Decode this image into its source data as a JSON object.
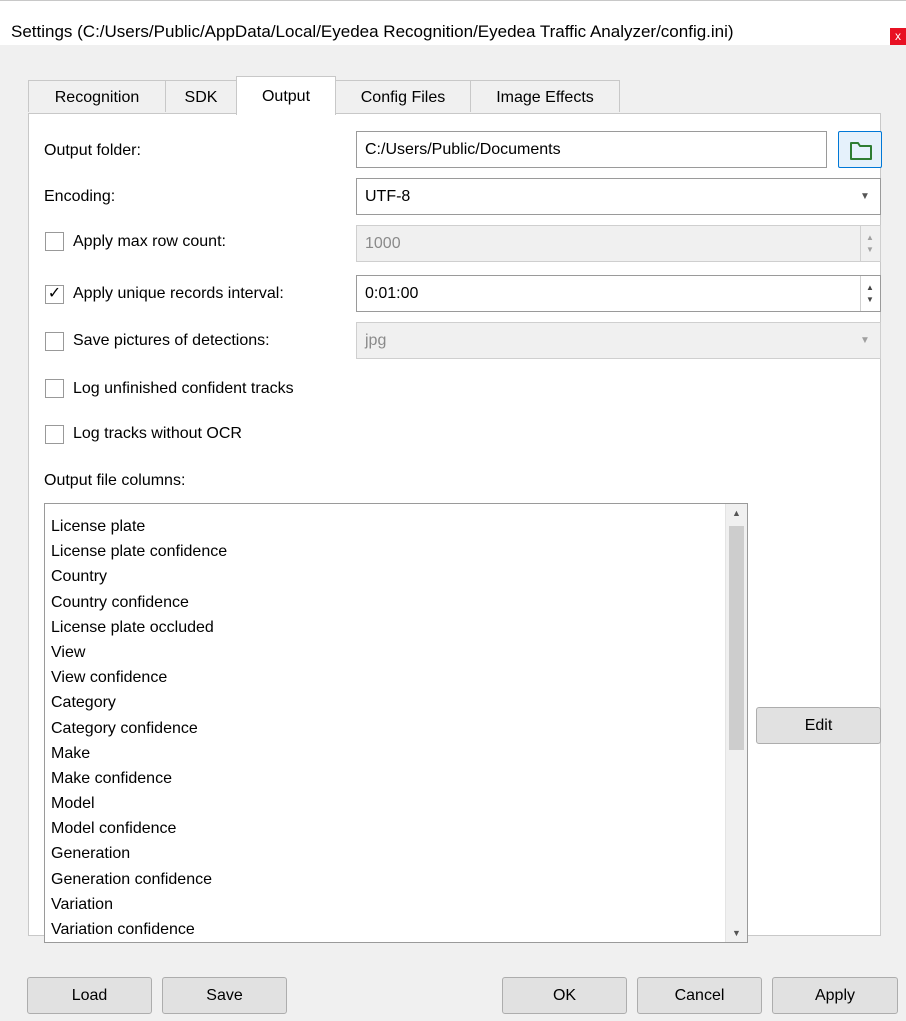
{
  "window": {
    "title": "Settings (C:/Users/Public/AppData/Local/Eyedea Recognition/Eyedea Traffic Analyzer/config.ini)",
    "close_glyph": "x"
  },
  "tabs": [
    {
      "label": "Recognition",
      "active": false
    },
    {
      "label": "SDK",
      "active": false
    },
    {
      "label": "Output",
      "active": true
    },
    {
      "label": "Config Files",
      "active": false
    },
    {
      "label": "Image Effects",
      "active": false
    }
  ],
  "output": {
    "output_folder_label": "Output folder:",
    "output_folder_value": "C:/Users/Public/Documents",
    "browse_icon": "folder-icon",
    "encoding_label": "Encoding:",
    "encoding_value": "UTF-8",
    "max_row_label": "Apply max row count:",
    "max_row_checked": false,
    "max_row_value": "1000",
    "unique_interval_label": "Apply unique records interval:",
    "unique_interval_checked": true,
    "unique_interval_value": "0:01:00",
    "save_pictures_label": "Save pictures of detections:",
    "save_pictures_checked": false,
    "save_pictures_format": "jpg",
    "log_unfinished_label": "Log unfinished confident tracks",
    "log_unfinished_checked": false,
    "log_without_ocr_label": "Log tracks without OCR",
    "log_without_ocr_checked": false,
    "columns_label": "Output file columns:",
    "columns": [
      "License plate",
      "License plate confidence",
      "Country",
      "Country confidence",
      "License plate occluded",
      "View",
      "View confidence",
      "Category",
      "Category confidence",
      "Make",
      "Make confidence",
      "Model",
      "Model confidence",
      "Generation",
      "Generation confidence",
      "Variation",
      "Variation confidence"
    ],
    "edit_label": "Edit"
  },
  "footer": {
    "load": "Load",
    "save": "Save",
    "ok": "OK",
    "cancel": "Cancel",
    "apply": "Apply"
  },
  "colors": {
    "accent": "#0078d7",
    "close": "#e81123",
    "folder_icon": "#2e7d32"
  },
  "checkmark_glyph": "✓"
}
